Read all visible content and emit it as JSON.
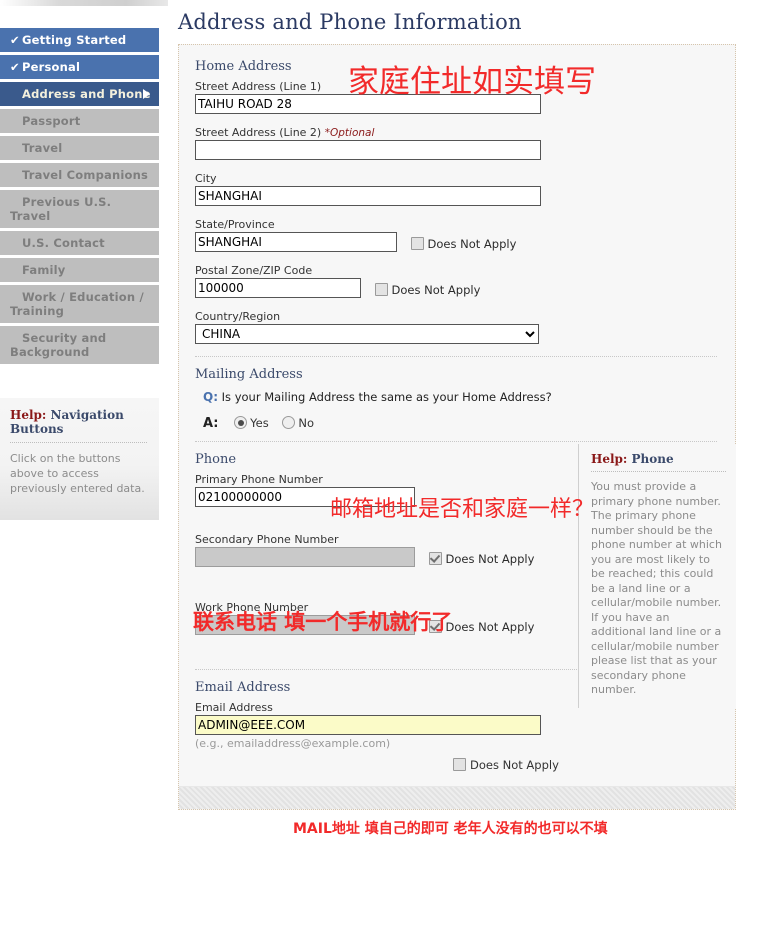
{
  "page_title": "Address and Phone Information",
  "sidebar": {
    "items": [
      {
        "label": "Getting Started",
        "state": "done"
      },
      {
        "label": "Personal",
        "state": "done"
      },
      {
        "label": "Address and Phone",
        "state": "active"
      },
      {
        "label": "Passport",
        "state": "pending"
      },
      {
        "label": "Travel",
        "state": "pending"
      },
      {
        "label": "Travel Companions",
        "state": "pending"
      },
      {
        "label": "Previous U.S. Travel",
        "state": "pending"
      },
      {
        "label": "U.S. Contact",
        "state": "pending"
      },
      {
        "label": "Family",
        "state": "pending"
      },
      {
        "label": "Work / Education / Training",
        "state": "pending"
      },
      {
        "label": "Security and Background",
        "state": "pending"
      }
    ],
    "check_glyph": "✔",
    "help": {
      "title_red": "Help:",
      "title_rest": " Navigation Buttons",
      "body": "Click on the buttons above to access previously entered data."
    }
  },
  "home_address": {
    "heading": "Home Address",
    "street1_label": "Street Address (Line 1)",
    "street1_value": "TAIHU ROAD 28",
    "street2_label": "Street Address (Line 2) ",
    "street2_optional": "*Optional",
    "street2_value": "",
    "city_label": "City",
    "city_value": "SHANGHAI",
    "state_label": "State/Province",
    "state_value": "SHANGHAI",
    "state_dna_label": "Does Not Apply",
    "state_dna_checked": false,
    "postal_label": "Postal Zone/ZIP Code",
    "postal_value": "100000",
    "postal_dna_label": "Does Not Apply",
    "postal_dna_checked": false,
    "country_label": "Country/Region",
    "country_value": "CHINA"
  },
  "mailing_address": {
    "heading": "Mailing Address",
    "q_marker": "Q:",
    "question": "Is your Mailing Address the same as your Home Address?",
    "a_marker": "A:",
    "yes_label": "Yes",
    "no_label": "No",
    "selected": "Yes"
  },
  "phone": {
    "heading": "Phone",
    "primary_label": "Primary Phone Number",
    "primary_value": "02100000000",
    "secondary_label": "Secondary Phone Number",
    "secondary_value": "",
    "secondary_dna_label": "Does Not Apply",
    "secondary_dna_checked": true,
    "work_label": "Work Phone Number",
    "work_value": "",
    "work_dna_label": "Does Not Apply",
    "work_dna_checked": true,
    "help": {
      "title_red": "Help:",
      "title_rest": " Phone",
      "body": "You must provide a primary phone number. The primary phone number should be the phone number at which you are most likely to be reached; this could be a land line or a cellular/mobile number. If you have an additional land line or a cellular/mobile number please list that as your secondary phone number."
    }
  },
  "email": {
    "heading": "Email Address",
    "field_label": "Email Address",
    "value": "ADMIN@EEE.COM",
    "hint": "(e.g., emailaddress@example.com)",
    "dna_label": "Does Not Apply",
    "dna_checked": false
  },
  "annotations": {
    "home": "家庭住址如实填写",
    "mailing": "邮箱地址是否和家庭一样？",
    "phone": "联系电话 填一个手机就行了",
    "email": "MAIL地址 填自己的即可 老年人没有的也可以不填",
    "color": "#f22a2a"
  }
}
